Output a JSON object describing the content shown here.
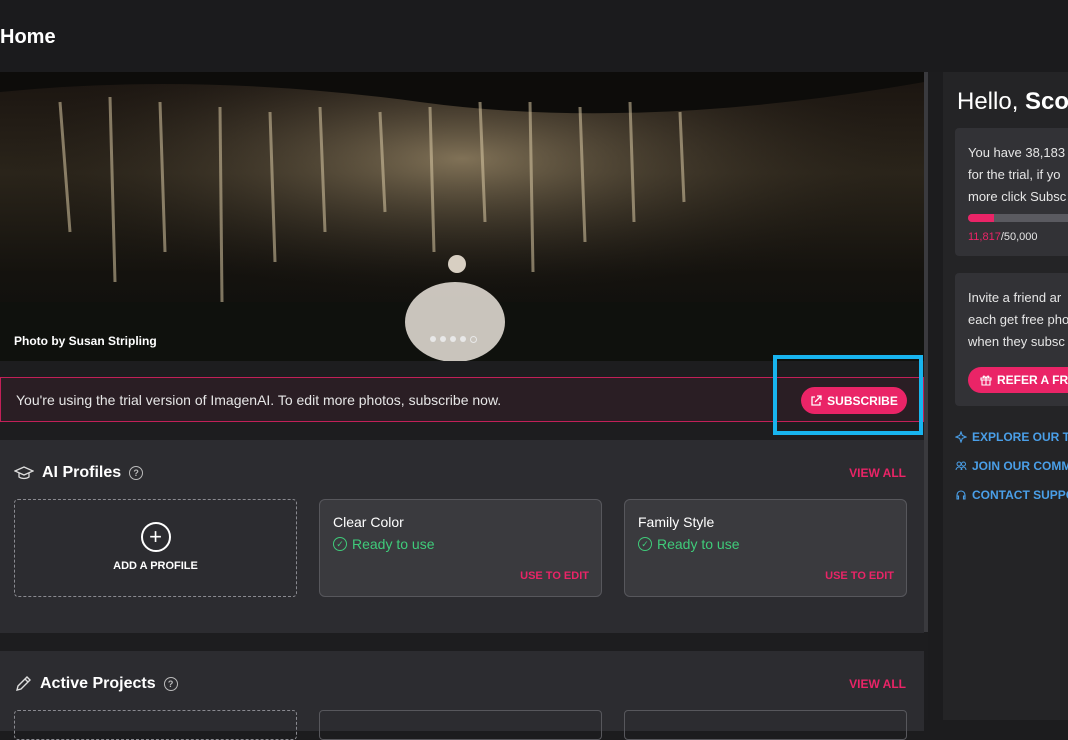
{
  "header": {
    "title": "Home"
  },
  "hero": {
    "credit": "Photo by Susan Stripling",
    "slides": 5,
    "active_slide": 4
  },
  "trial": {
    "message": "You're using the trial version of ImagenAI. To edit more photos, subscribe now.",
    "subscribe_label": "SUBSCRIBE"
  },
  "profiles": {
    "title": "AI Profiles",
    "help": "?",
    "view_all": "VIEW ALL",
    "add_label": "ADD A PROFILE",
    "cards": [
      {
        "name": "Clear Color",
        "status": "Ready to use",
        "action": "USE TO EDIT"
      },
      {
        "name": "Family Style",
        "status": "Ready to use",
        "action": "USE TO EDIT"
      }
    ]
  },
  "projects": {
    "title": "Active Projects",
    "help": "?",
    "view_all": "VIEW ALL"
  },
  "sidebar": {
    "greeting": "Hello,",
    "user": "Scot",
    "quota_lines": [
      "You have 38,183",
      "for the trial, if yo",
      "more click Subsc"
    ],
    "quota_used": "11,817",
    "quota_total": "/50,000",
    "quota_fraction": 0.236,
    "refer_lines": [
      "Invite a friend ar",
      "each get free pho",
      "when they subsc"
    ],
    "refer_label": "REFER A FRIE",
    "links": [
      "EXPLORE OUR TAL",
      "JOIN OUR COMMU",
      "CONTACT SUPPOR"
    ]
  },
  "colors": {
    "accent": "#ea2467",
    "success": "#3fcb7a",
    "link": "#4a9fe8",
    "highlight": "#18b4ee"
  }
}
